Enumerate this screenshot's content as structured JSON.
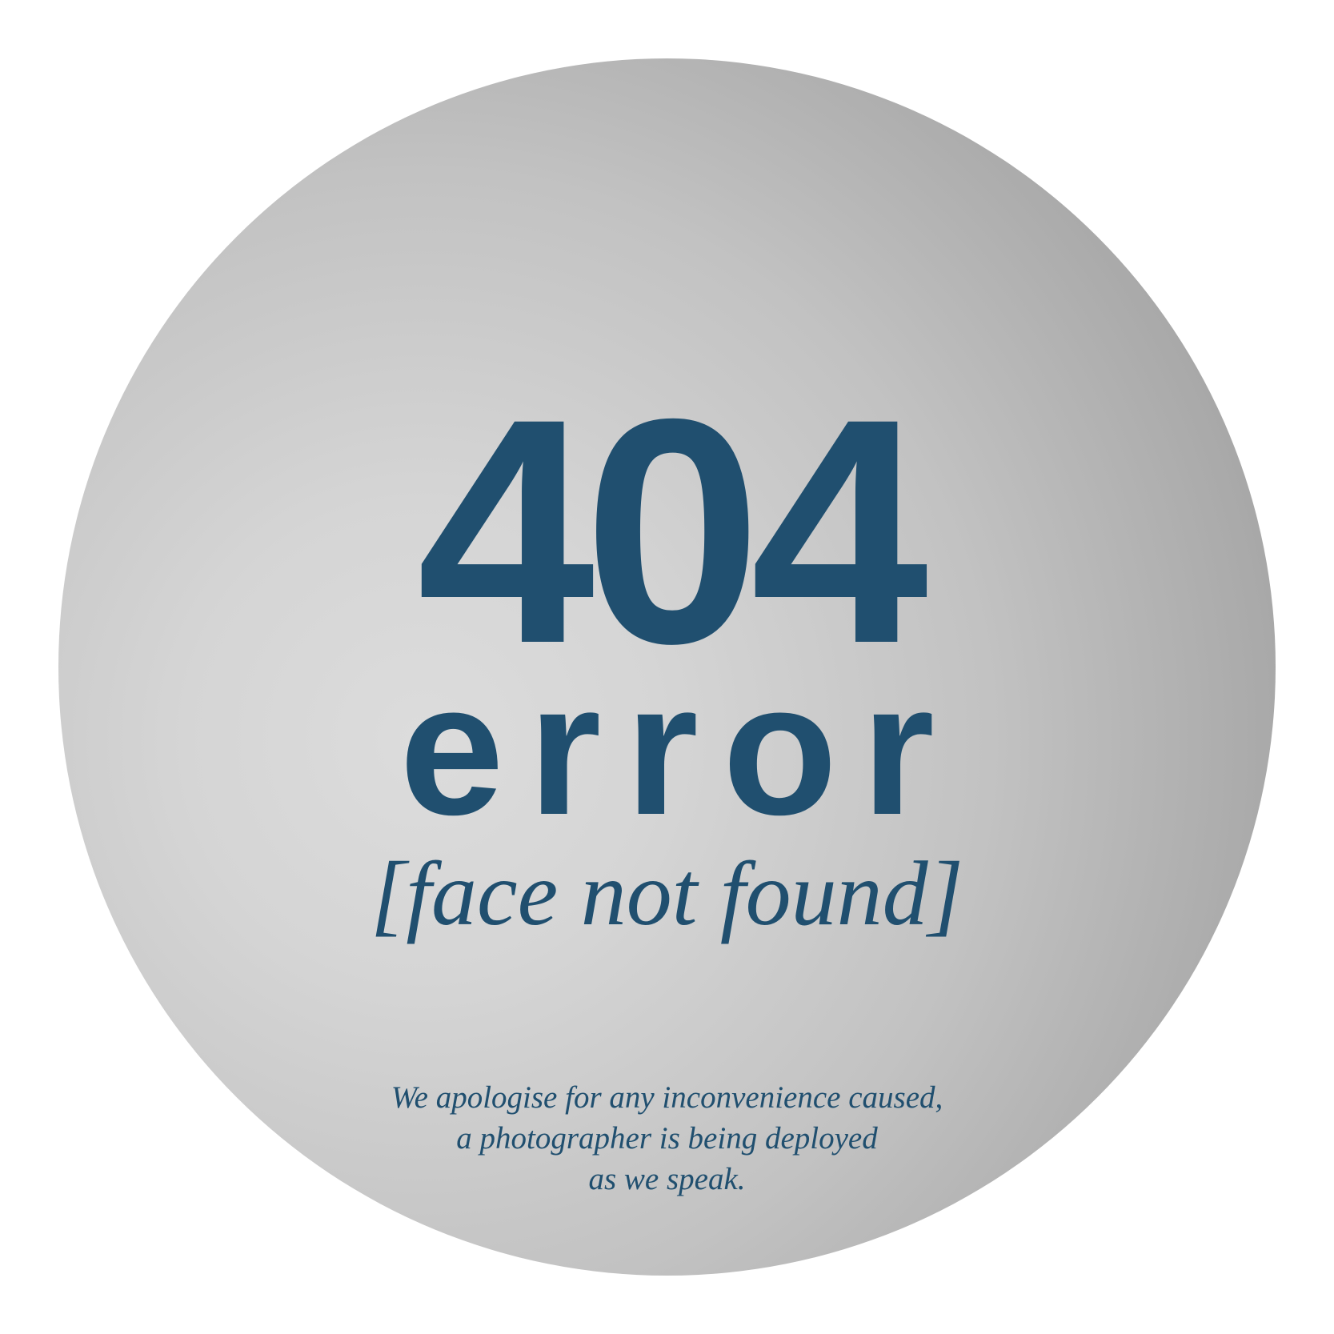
{
  "error": {
    "code": "404",
    "word": "error",
    "tagline": "[face not found]",
    "message_lines": [
      "We apologise for any inconvenience caused,",
      "a photographer is being deployed",
      "as we speak."
    ]
  },
  "colors": {
    "text": "#204f6f",
    "disc_light": "#dcdcdc",
    "disc_dark": "#8f8f8f",
    "background": "#ffffff"
  }
}
